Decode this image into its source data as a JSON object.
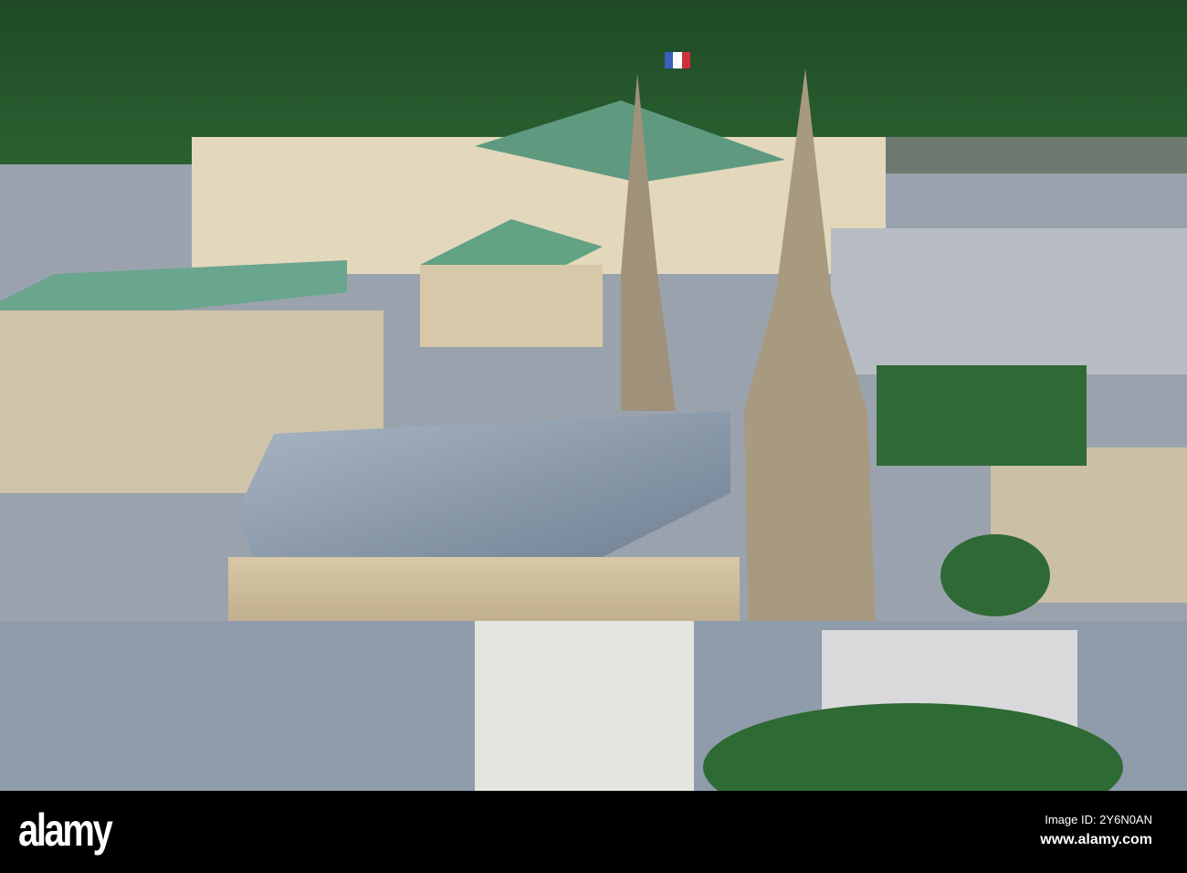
{
  "watermark": {
    "logo": "alamy",
    "image_id": "Image ID: 2Y6N0AN",
    "site": "www.alamy.com"
  }
}
